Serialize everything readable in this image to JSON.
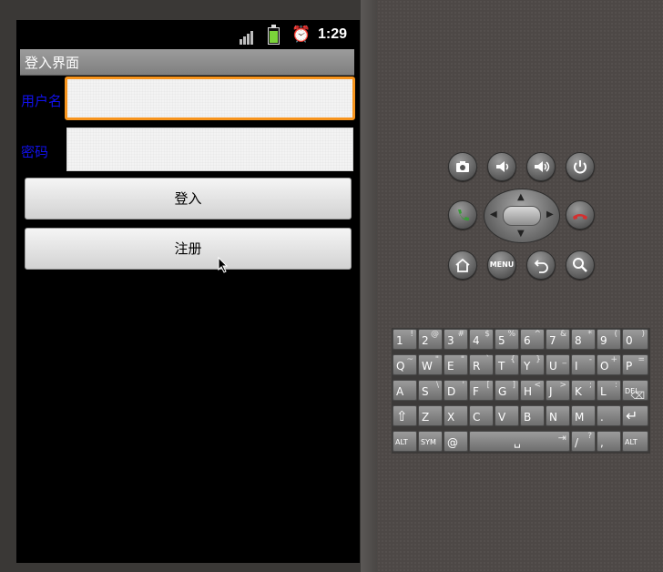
{
  "status_bar": {
    "time": "1:29",
    "signal_icon": "signal-icon",
    "battery_icon": "battery-icon",
    "alarm_icon": "alarm-icon"
  },
  "title_bar": {
    "title": "登入界面"
  },
  "form": {
    "username_label": "用户名",
    "username_value": "",
    "password_label": "密码",
    "password_value": ""
  },
  "buttons": {
    "login": "登入",
    "register": "注册"
  },
  "controls": {
    "icons": [
      "camera-icon",
      "volume-down-icon",
      "volume-up-icon",
      "power-icon",
      "call-icon",
      "end-call-icon",
      "home-icon",
      "menu-icon",
      "back-icon",
      "search-icon"
    ],
    "menu_label": "MENU"
  },
  "keyboard": {
    "row1": [
      [
        "1",
        "!"
      ],
      [
        "2",
        "@"
      ],
      [
        "3",
        "#"
      ],
      [
        "4",
        "$"
      ],
      [
        "5",
        "%"
      ],
      [
        "6",
        "^"
      ],
      [
        "7",
        "&"
      ],
      [
        "8",
        "*"
      ],
      [
        "9",
        "("
      ],
      [
        "0",
        ")"
      ]
    ],
    "row2": [
      [
        "Q",
        "~"
      ],
      [
        "W",
        "\""
      ],
      [
        "E",
        "\""
      ],
      [
        "R",
        "`"
      ],
      [
        "T",
        "{"
      ],
      [
        "Y",
        "}"
      ],
      [
        "U",
        "_"
      ],
      [
        "I",
        "-"
      ],
      [
        "O",
        "+"
      ],
      [
        "P",
        "="
      ]
    ],
    "row3": [
      [
        "A",
        ""
      ],
      [
        "S",
        "\\"
      ],
      [
        "D",
        "'"
      ],
      [
        "F",
        "["
      ],
      [
        "G",
        "]"
      ],
      [
        "H",
        "<"
      ],
      [
        "J",
        ">"
      ],
      [
        "K",
        ";"
      ],
      [
        "L",
        ":"
      ],
      [
        "DEL",
        "⌫"
      ]
    ],
    "row4": [
      [
        "⇧",
        ""
      ],
      [
        "Z",
        ""
      ],
      [
        "X",
        ""
      ],
      [
        "C",
        ""
      ],
      [
        "V",
        ""
      ],
      [
        "B",
        ""
      ],
      [
        "N",
        ""
      ],
      [
        "M",
        ""
      ],
      [
        ".",
        ""
      ],
      [
        "↵",
        ""
      ]
    ],
    "row5": [
      [
        "ALT",
        ""
      ],
      [
        "SYM",
        ""
      ],
      [
        "@",
        ""
      ],
      [
        "␣",
        "⇥"
      ],
      [
        "/",
        "?"
      ],
      [
        ",",
        ""
      ],
      [
        "ALT",
        ""
      ]
    ]
  },
  "colors": {
    "focus_border": "#f7941d",
    "label_color": "#1111ee",
    "call_green": "#3a9a3a",
    "end_red": "#d43030"
  }
}
